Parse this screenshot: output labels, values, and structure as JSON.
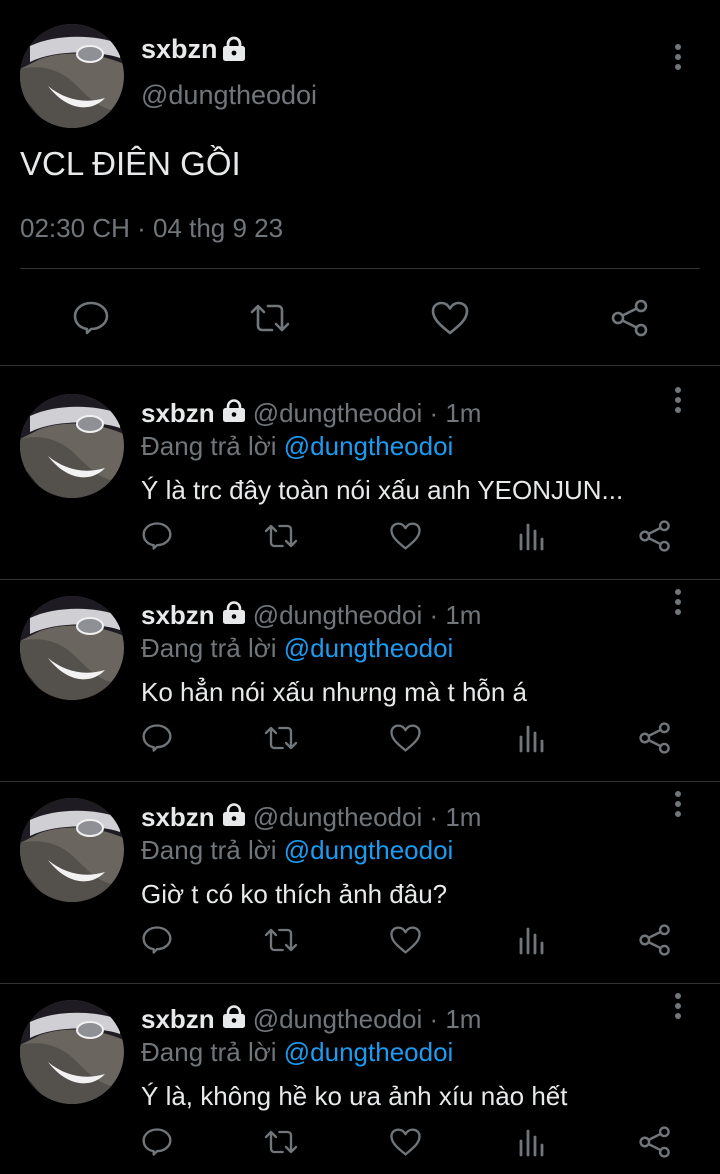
{
  "main_tweet": {
    "display_name": "sxbzn",
    "handle": "@dungtheodoi",
    "text": "VCL ĐIÊN GỒI",
    "timestamp": "02:30 CH · 04 thg 9 23",
    "actions": [
      "reply-icon",
      "retweet-icon",
      "like-icon",
      "share-icon"
    ]
  },
  "replies": [
    {
      "display_name": "sxbzn",
      "handle": "@dungtheodoi",
      "time": "· 1m",
      "replying_prefix": "Đang trả lời ",
      "replying_to": "@dungtheodoi",
      "text": "Ý là trc đây toàn nói xấu anh YEONJUN..."
    },
    {
      "display_name": "sxbzn",
      "handle": "@dungtheodoi",
      "time": "· 1m",
      "replying_prefix": "Đang trả lời ",
      "replying_to": "@dungtheodoi",
      "text": "Ko hẳn nói xấu nhưng mà t hỗn á"
    },
    {
      "display_name": "sxbzn",
      "handle": "@dungtheodoi",
      "time": "· 1m",
      "replying_prefix": "Đang trả lời ",
      "replying_to": "@dungtheodoi",
      "text": "Giờ t có ko thích ảnh đâu?"
    },
    {
      "display_name": "sxbzn",
      "handle": "@dungtheodoi",
      "time": "· 1m",
      "replying_prefix": "Đang trả lời ",
      "replying_to": "@dungtheodoi",
      "text": "Ý là, không hề ko ưa ảnh xíu nào hết"
    }
  ],
  "reply_actions": [
    "reply-icon",
    "retweet-icon",
    "like-icon",
    "views-icon",
    "share-icon"
  ],
  "colors": {
    "background": "#000000",
    "text": "#e7e9ea",
    "secondary": "#71767b",
    "accent": "#1d9bf0",
    "divider": "#2f3336"
  }
}
